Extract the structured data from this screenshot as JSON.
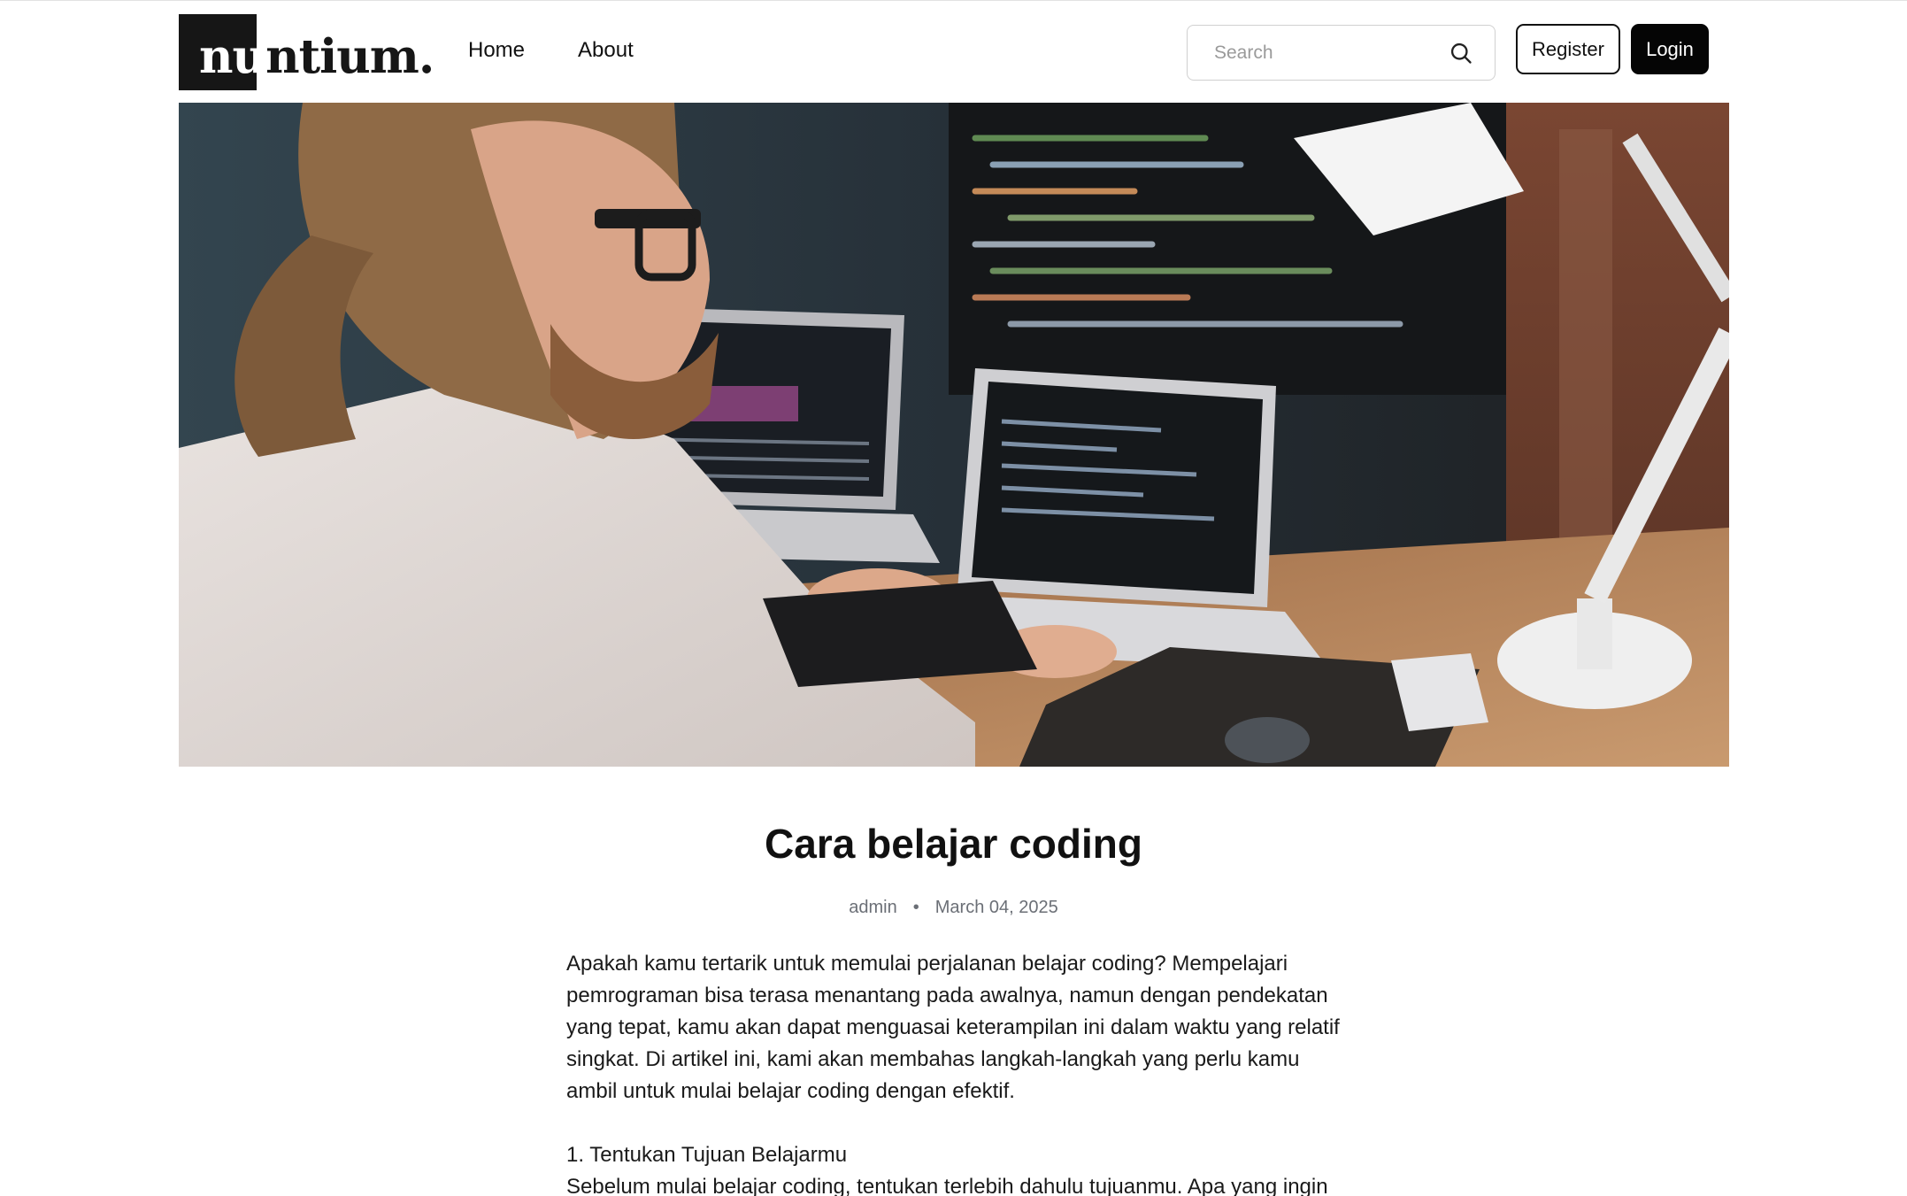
{
  "header": {
    "logo_text": "nuntium.",
    "logo_inv": "nu",
    "logo_rest": "ntium.",
    "nav": [
      {
        "label": "Home"
      },
      {
        "label": "About"
      }
    ],
    "search": {
      "placeholder": "Search"
    },
    "register_label": "Register",
    "login_label": "Login"
  },
  "hero": {
    "icon": "hero-image"
  },
  "article": {
    "title": "Cara belajar coding",
    "author": "admin",
    "separator": "•",
    "date": "March 04, 2025",
    "intro": "Apakah kamu tertarik untuk memulai perjalanan belajar coding? Mempelajari pemrograman bisa terasa menantang pada awalnya, namun dengan pendekatan yang tepat, kamu akan dapat menguasai keterampilan ini dalam waktu yang relatif singkat. Di artikel ini, kami akan membahas langkah-langkah yang perlu kamu ambil untuk mulai belajar coding dengan efektif.",
    "section1_heading": "1. Tentukan Tujuan Belajarmu",
    "section1_text": "Sebelum mulai belajar coding, tentukan terlebih dahulu tujuanmu. Apa yang ingin"
  },
  "colors": {
    "accent": "#050505",
    "text": "#111111",
    "meta": "#6b6f76"
  }
}
